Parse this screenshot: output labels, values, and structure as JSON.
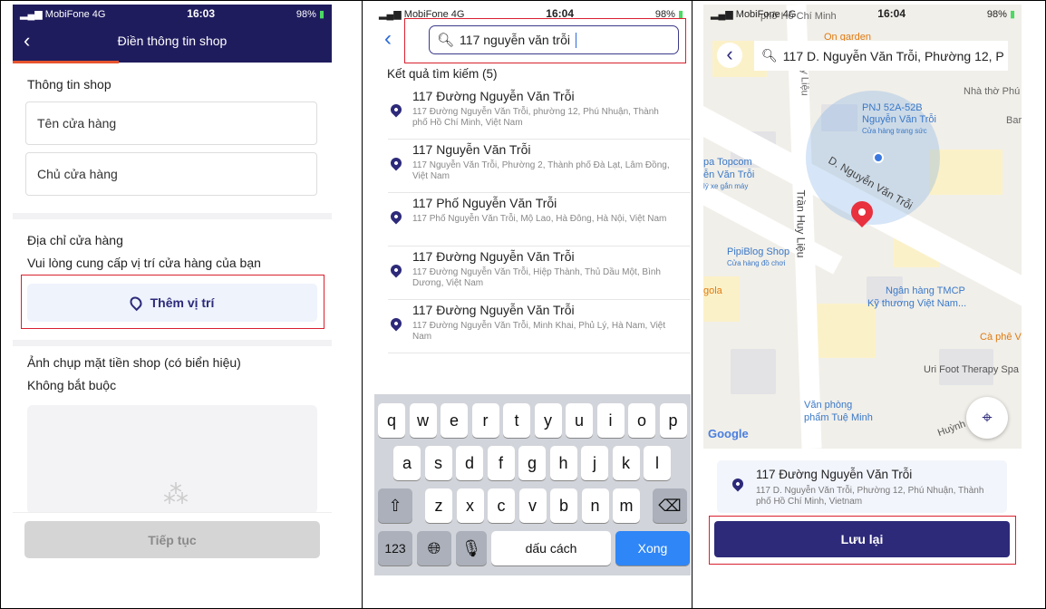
{
  "screen1": {
    "status": {
      "carrier": "MobiFone",
      "network": "4G",
      "time": "16:03",
      "battery": "98%"
    },
    "header_title": "Điền thông tin shop",
    "section_shop_info": "Thông tin shop",
    "fields": [
      {
        "placeholder": "Tên cửa hàng"
      },
      {
        "placeholder": "Chủ cửa hàng"
      }
    ],
    "address_title": "Địa chỉ cửa hàng",
    "address_hint": "Vui lòng cung cấp vị trí cửa hàng của bạn",
    "add_location_label": "Thêm vị trí",
    "photo_title": "Ảnh chụp mặt tiền shop (có biển hiệu)",
    "photo_hint": "Không bắt buộc",
    "continue_label": "Tiếp tục",
    "progress_percent": 33
  },
  "screen2": {
    "status": {
      "carrier": "MobiFone",
      "network": "4G",
      "time": "16:04",
      "battery": "98%"
    },
    "search_value": "117 nguyễn văn trỗi",
    "results_title": "Kết quả tìm kiếm (5)",
    "results": [
      {
        "title": "117 Đường Nguyễn Văn Trỗi",
        "subtitle": "117 Đường Nguyễn Văn Trỗi, phường 12, Phú Nhuận, Thành phố Hồ Chí Minh, Việt Nam"
      },
      {
        "title": "117 Nguyễn Văn Trỗi",
        "subtitle": "117 Nguyễn Văn Trỗi, Phường 2, Thành phố Đà Lạt, Lâm Đồng, Việt Nam"
      },
      {
        "title": "117 Phố Nguyễn Văn Trỗi",
        "subtitle": "117 Phố Nguyễn Văn Trỗi, Mộ Lao, Hà Đông, Hà Nội, Việt Nam"
      },
      {
        "title": "117 Đường Nguyễn Văn Trỗi",
        "subtitle": "117 Đường Nguyễn Văn Trỗi, Hiệp Thành, Thủ Dầu Một, Bình Dương, Việt Nam"
      },
      {
        "title": "117 Đường Nguyễn Văn Trỗi",
        "subtitle": "117 Đường Nguyễn Văn Trỗi, Minh Khai, Phủ Lý, Hà Nam, Việt Nam"
      }
    ],
    "keyboard": {
      "row1": [
        "q",
        "w",
        "e",
        "r",
        "t",
        "y",
        "u",
        "i",
        "o",
        "p"
      ],
      "row2": [
        "a",
        "s",
        "d",
        "f",
        "g",
        "h",
        "j",
        "k",
        "l"
      ],
      "row3": [
        "z",
        "x",
        "c",
        "v",
        "b",
        "n",
        "m"
      ],
      "numbers": "123",
      "space": "dấu cách",
      "done": "Xong"
    }
  },
  "screen3": {
    "status": {
      "carrier": "MobiFone",
      "network": "4G",
      "time": "16:04",
      "battery": "98%"
    },
    "search_value": "117 D. Nguyễn Văn Trỗi, Phường 12, P",
    "map_labels": {
      "l1": "phở Hồ Chí Minh",
      "l2": "On garden",
      "l3": "Nhà thờ Phú",
      "l4": "PNJ 52A-52B",
      "l5": "Nguyễn Văn Trỗi",
      "l6": "Cửa hàng trang sức",
      "l7": "Bar",
      "l8": "pa Topcom",
      "l9": "ễn Văn Trỗi",
      "l10": "lý xe gắn máy",
      "l11": "D. Nguyễn Văn Trỗi",
      "l12": "Trần Huy Liệu",
      "l13": "PipiBlog Shop",
      "l14": "Cửa hàng đồ chơi",
      "l15": "gola",
      "l16": "Ngân hàng TMCP",
      "l17": "Kỹ thương Việt Nam...",
      "l18": "Cà phê V",
      "l19": "Uri Foot Therapy Spa",
      "l20": "Văn phòng",
      "l21": "phẩm Tuệ Minh",
      "l22": "Huỳnh",
      "l23": "Google",
      "l24": "y Liệu"
    },
    "selected": {
      "title": "117 Đường Nguyễn Văn Trỗi",
      "subtitle": "117 D. Nguyễn Văn Trỗi, Phường 12, Phú Nhuận, Thành phố Hồ Chí Minh, Vietnam"
    },
    "save_label": "Lưu lại"
  },
  "colors": {
    "primary": "#2d2a7a",
    "header": "#1f1c5e",
    "highlight": "#d9202f",
    "progress": "#e8542f",
    "map_pin": "#e8303f"
  }
}
